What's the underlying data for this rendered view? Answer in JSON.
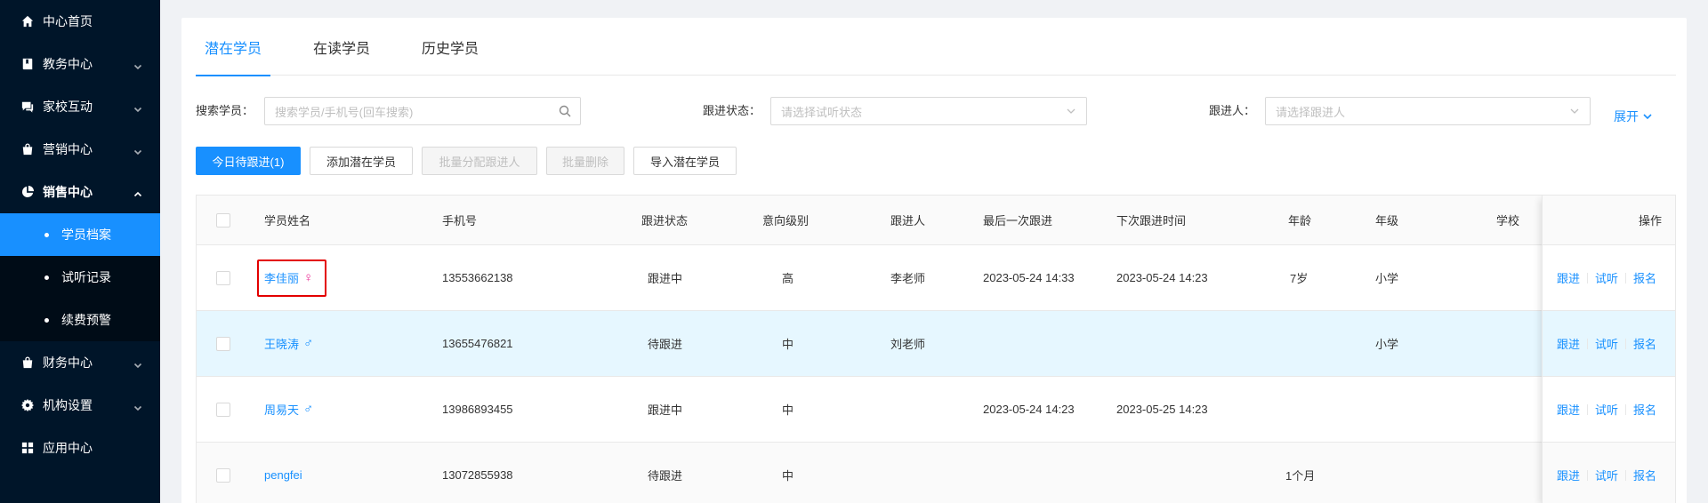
{
  "sidebar": {
    "items": [
      {
        "label": "中心首页",
        "icon": "home-icon"
      },
      {
        "label": "教务中心",
        "icon": "book-icon"
      },
      {
        "label": "家校互动",
        "icon": "chat-icon"
      },
      {
        "label": "营销中心",
        "icon": "bag-icon"
      },
      {
        "label": "销售中心",
        "icon": "chart-icon"
      },
      {
        "label": "财务中心",
        "icon": "wallet-icon"
      },
      {
        "label": "机构设置",
        "icon": "gear-icon"
      },
      {
        "label": "应用中心",
        "icon": "grid-icon"
      }
    ],
    "submenu": [
      {
        "label": "学员档案",
        "active": true
      },
      {
        "label": "试听记录",
        "active": false
      },
      {
        "label": "续费预警",
        "active": false
      }
    ]
  },
  "tabs": [
    {
      "label": "潜在学员",
      "active": true
    },
    {
      "label": "在读学员",
      "active": false
    },
    {
      "label": "历史学员",
      "active": false
    }
  ],
  "filters": {
    "search_label": "搜索学员：",
    "search_placeholder": "搜索学员/手机号(回车搜索)",
    "status_label": "跟进状态：",
    "status_placeholder": "请选择试听状态",
    "follower_label": "跟进人：",
    "follower_placeholder": "请选择跟进人",
    "expand_label": "展开"
  },
  "toolbar": {
    "today_followup": "今日待跟进(1)",
    "add_potential": "添加潜在学员",
    "batch_assign": "批量分配跟进人",
    "batch_delete": "批量删除",
    "import_potential": "导入潜在学员"
  },
  "table": {
    "headers": {
      "name": "学员姓名",
      "phone": "手机号",
      "status": "跟进状态",
      "intent": "意向级别",
      "follower": "跟进人",
      "last_followup": "最后一次跟进",
      "next_followup": "下次跟进时间",
      "age": "年龄",
      "grade": "年级",
      "school": "学校",
      "actions": "操作"
    },
    "rows": [
      {
        "name": "李佳丽",
        "gender": "♀",
        "phone": "13553662138",
        "status": "跟进中",
        "intent": "高",
        "follower": "李老师",
        "last_followup": "2023-05-24 14:33",
        "next_followup": "2023-05-24 14:23",
        "age": "7岁",
        "grade": "小学",
        "school": ""
      },
      {
        "name": "王晓涛",
        "gender": "♂",
        "phone": "13655476821",
        "status": "待跟进",
        "intent": "中",
        "follower": "刘老师",
        "last_followup": "",
        "next_followup": "",
        "age": "",
        "grade": "小学",
        "school": ""
      },
      {
        "name": "周易天",
        "gender": "♂",
        "phone": "13986893455",
        "status": "跟进中",
        "intent": "中",
        "follower": "",
        "last_followup": "2023-05-24 14:23",
        "next_followup": "2023-05-25 14:23",
        "age": "",
        "grade": "",
        "school": ""
      },
      {
        "name": "pengfei",
        "gender": "",
        "phone": "13072855938",
        "status": "待跟进",
        "intent": "中",
        "follower": "",
        "last_followup": "",
        "next_followup": "",
        "age": "1个月",
        "grade": "",
        "school": ""
      }
    ],
    "actions": {
      "follow": "跟进",
      "trial": "试听",
      "enroll": "报名"
    }
  }
}
